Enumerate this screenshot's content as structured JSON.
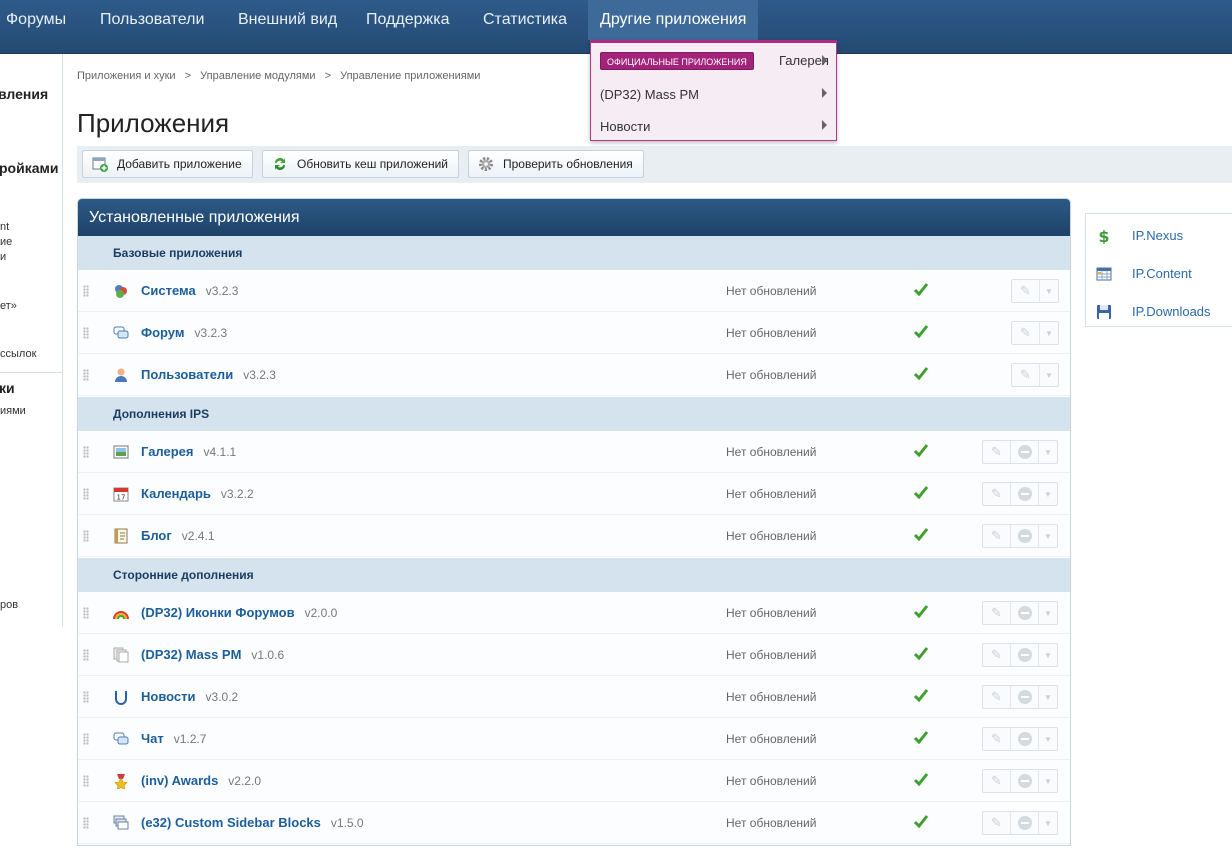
{
  "nav": {
    "items": [
      "Форумы",
      "Пользователи",
      "Внешний вид",
      "Поддержка",
      "Статистика",
      "Другие приложения"
    ]
  },
  "sidebar": {
    "lines": [
      "вления",
      "ройками",
      "nt",
      "ие",
      "и",
      "ет»",
      "ссылок",
      "ки",
      "иями",
      "ров"
    ]
  },
  "breadcrumb": [
    "Приложения и хуки",
    ">",
    "Управление модулями",
    ">",
    "Управление приложениями"
  ],
  "page_title": "Приложения",
  "toolbar": {
    "add_label": "Добавить приложение",
    "refresh_label": "Обновить кеш приложений",
    "check_label": "Проверить обновления"
  },
  "panel": {
    "title": "Установленные приложения",
    "sections": [
      {
        "title": "Базовые приложения",
        "apps": [
          {
            "name": "Система",
            "version": "v3.2.3",
            "status": "Нет обновлений",
            "icon": "system-icon"
          },
          {
            "name": "Форум",
            "version": "v3.2.3",
            "status": "Нет обновлений",
            "icon": "forum-icon"
          },
          {
            "name": "Пользователи",
            "version": "v3.2.3",
            "status": "Нет обновлений",
            "icon": "members-icon"
          }
        ]
      },
      {
        "title": "Дополнения IPS",
        "apps": [
          {
            "name": "Галерея",
            "version": "v4.1.1",
            "status": "Нет обновлений",
            "icon": "gallery-icon"
          },
          {
            "name": "Календарь",
            "version": "v3.2.2",
            "status": "Нет обновлений",
            "icon": "calendar-icon"
          },
          {
            "name": "Блог",
            "version": "v2.4.1",
            "status": "Нет обновлений",
            "icon": "blog-icon"
          }
        ]
      },
      {
        "title": "Сторонние дополнения",
        "apps": [
          {
            "name": "(DP32) Иконки Форумов",
            "version": "v2.0.0",
            "status": "Нет обновлений",
            "icon": "rainbow-icon"
          },
          {
            "name": "(DP32) Mass PM",
            "version": "v1.0.6",
            "status": "Нет обновлений",
            "icon": "mass-pm-icon"
          },
          {
            "name": "Новости",
            "version": "v3.0.2",
            "status": "Нет обновлений",
            "icon": "news-icon"
          },
          {
            "name": "Чат",
            "version": "v1.2.7",
            "status": "Нет обновлений",
            "icon": "chat-icon"
          },
          {
            "name": "(inv) Awards",
            "version": "v2.2.0",
            "status": "Нет обновлений",
            "icon": "award-icon"
          },
          {
            "name": "(e32) Custom Sidebar Blocks",
            "version": "v1.5.0",
            "status": "Нет обновлений",
            "icon": "sidebar-blocks-icon"
          }
        ]
      }
    ]
  },
  "sidebox": {
    "items": [
      "IP.Nexus",
      "IP.Content",
      "IP.Downloads"
    ]
  },
  "dropdown": {
    "badge": "ОФИЦИАЛЬНЫЕ ПРИЛОЖЕНИЯ",
    "items": [
      "Галерея",
      "(DP32) Mass PM",
      "Новости"
    ]
  }
}
